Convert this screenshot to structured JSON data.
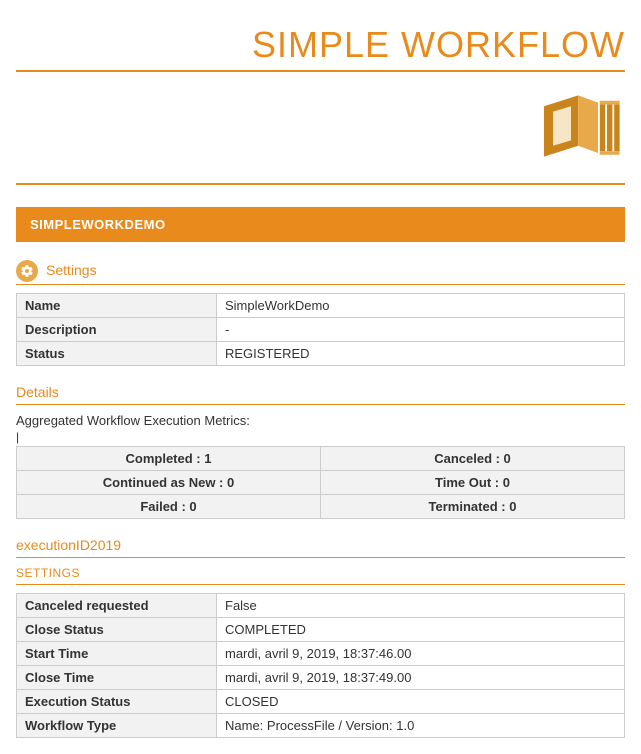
{
  "header": {
    "title": "SIMPLE WORKFLOW"
  },
  "banner": {
    "title": "SIMPLEWORKDEMO"
  },
  "settings": {
    "heading": "Settings",
    "rows": {
      "name_label": "Name",
      "name_value": "SimpleWorkDemo",
      "description_label": "Description",
      "description_value": "-",
      "status_label": "Status",
      "status_value": "REGISTERED"
    }
  },
  "details": {
    "heading": "Details",
    "caption": "Aggregated Workflow Execution Metrics:",
    "metrics": {
      "completed": "Completed : 1",
      "canceled": "Canceled : 0",
      "continued_as_new": "Continued as New : 0",
      "time_out": "Time Out : 0",
      "failed": "Failed : 0",
      "terminated": "Terminated : 0"
    }
  },
  "execution": {
    "heading": "executionID2019",
    "sub_heading": "SETTINGS",
    "rows": {
      "canceled_requested_label": "Canceled requested",
      "canceled_requested_value": "False",
      "close_status_label": "Close Status",
      "close_status_value": "COMPLETED",
      "start_time_label": "Start Time",
      "start_time_value": "mardi, avril 9, 2019, 18:37:46.00",
      "close_time_label": "Close Time",
      "close_time_value": "mardi, avril 9, 2019, 18:37:49.00",
      "execution_status_label": "Execution Status",
      "execution_status_value": "CLOSED",
      "workflow_type_label": "Workflow Type",
      "workflow_type_value": "Name: ProcessFile / Version: 1.0"
    }
  }
}
